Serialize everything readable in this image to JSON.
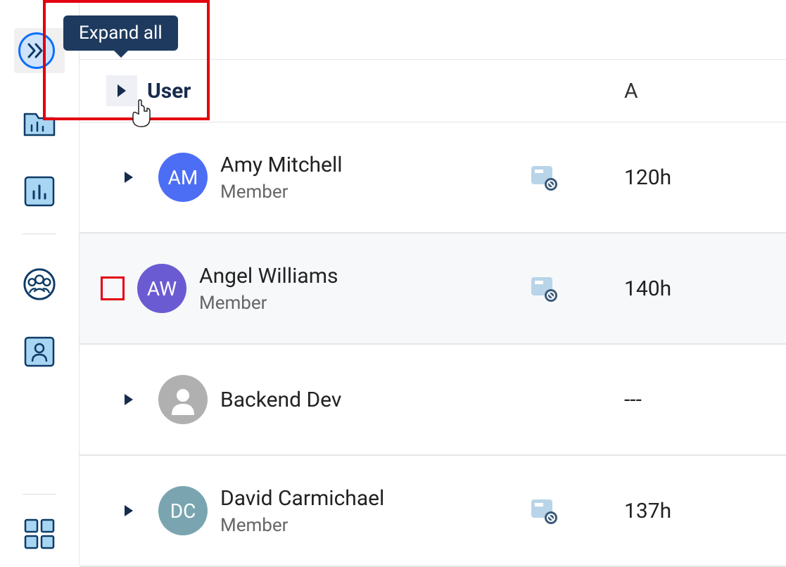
{
  "tooltip": {
    "expand_all": "Expand all"
  },
  "header": {
    "user_column": "User",
    "a_column": "A"
  },
  "rows": [
    {
      "initials": "AM",
      "name": "Amy Mitchell",
      "role": "Member",
      "value": "120h",
      "avatar_color": "#4c6ef5",
      "has_icon": true
    },
    {
      "initials": "AW",
      "name": "Angel Williams",
      "role": "Member",
      "value": "140h",
      "avatar_color": "#6b5bd2",
      "has_icon": true
    },
    {
      "initials": "",
      "name": "Backend Dev",
      "role": "",
      "value": "---",
      "avatar_color": "#b0b0b0",
      "has_icon": false
    },
    {
      "initials": "DC",
      "name": "David Carmichael",
      "role": "Member",
      "value": "137h",
      "avatar_color": "#7aa5b0",
      "has_icon": true
    }
  ]
}
